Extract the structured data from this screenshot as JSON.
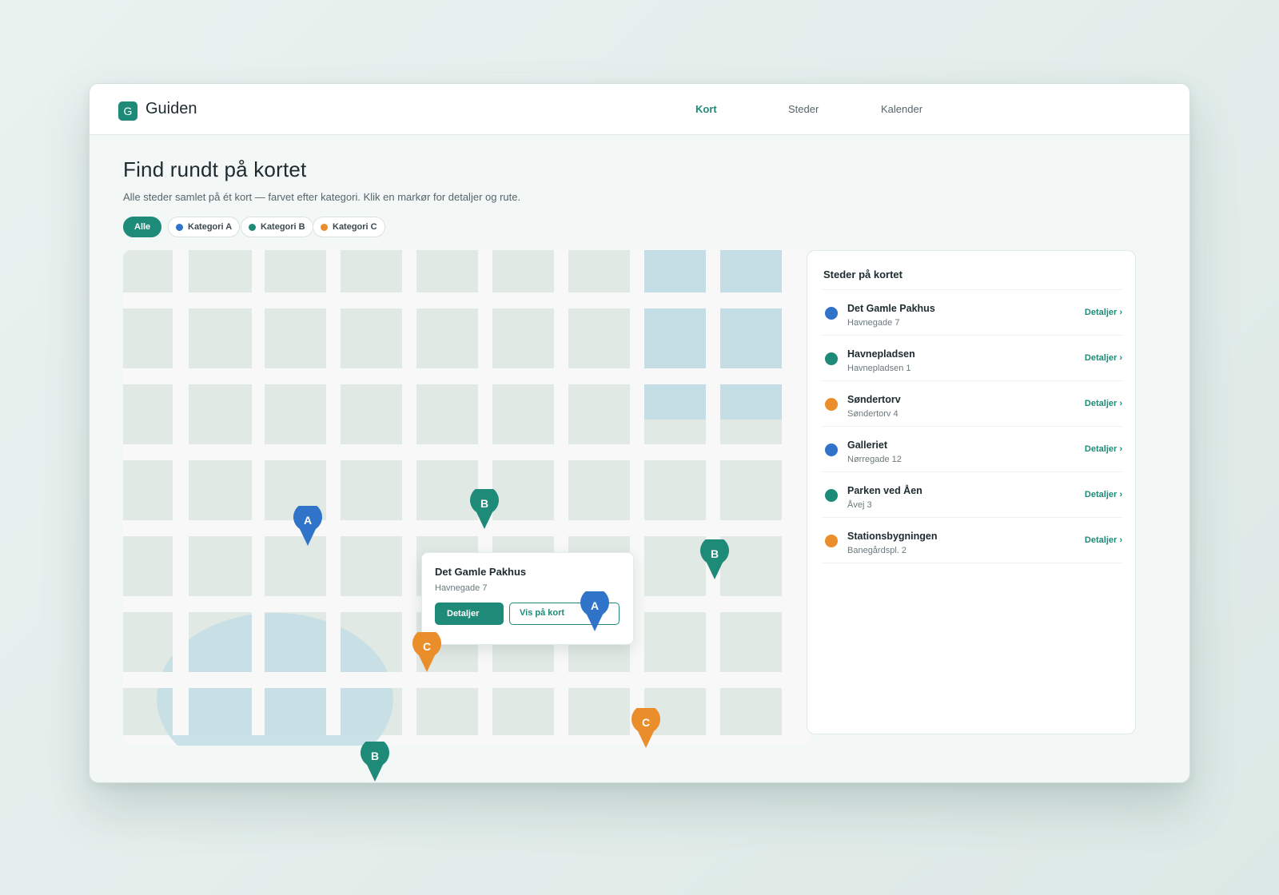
{
  "app": {
    "logo_letter": "G",
    "name": "Guiden"
  },
  "nav": [
    {
      "label": "Kort",
      "active": true
    },
    {
      "label": "Steder",
      "active": false
    },
    {
      "label": "Kalender",
      "active": false
    }
  ],
  "page": {
    "title": "Find rundt på kortet",
    "subtitle": "Alle steder samlet på ét kort — farvet efter kategori. Klik en markør for detaljer og rute."
  },
  "filters": [
    {
      "label": "Alle",
      "active": true,
      "color": null
    },
    {
      "label": "Kategori A",
      "active": false,
      "color": "#2f74c8"
    },
    {
      "label": "Kategori B",
      "active": false,
      "color": "#1e8a78"
    },
    {
      "label": "Kategori C",
      "active": false,
      "color": "#e98e2a"
    }
  ],
  "colors": {
    "accent": "#1e8a78",
    "category_a": "#2f74c8",
    "category_b": "#1e8a78",
    "category_c": "#e98e2a",
    "map_block": "#e1e9e4",
    "map_water": "#c5dee5"
  },
  "map": {
    "markers": [
      {
        "letter": "A",
        "category": "a"
      },
      {
        "letter": "B",
        "category": "b"
      },
      {
        "letter": "B",
        "category": "b"
      },
      {
        "letter": "A",
        "category": "a"
      },
      {
        "letter": "C",
        "category": "c"
      },
      {
        "letter": "C",
        "category": "c"
      },
      {
        "letter": "B",
        "category": "b"
      }
    ],
    "popup": {
      "title": "Det Gamle Pakhus",
      "address": "Havnegade 7",
      "primary_label": "Detaljer",
      "secondary_label": "Vis på kort"
    }
  },
  "sidebar": {
    "title": "Steder på kortet",
    "link_label": "Detaljer ›",
    "places": [
      {
        "name": "Det Gamle Pakhus",
        "address": "Havnegade 7",
        "category": "a"
      },
      {
        "name": "Havnepladsen",
        "address": "Havnepladsen 1",
        "category": "b"
      },
      {
        "name": "Søndertorv",
        "address": "Søndertorv 4",
        "category": "c"
      },
      {
        "name": "Galleriet",
        "address": "Nørregade 12",
        "category": "a"
      },
      {
        "name": "Parken ved Åen",
        "address": "Åvej 3",
        "category": "b"
      },
      {
        "name": "Stationsbygningen",
        "address": "Banegårdspl. 2",
        "category": "c"
      }
    ]
  }
}
